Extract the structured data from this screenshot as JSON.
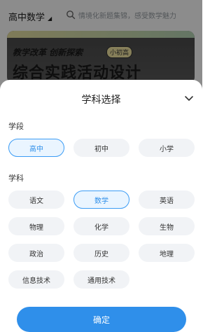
{
  "header": {
    "subject_label": "高中数学",
    "search_placeholder": "情境化新题集锦，感受数学魅力"
  },
  "banner": {
    "line1": "教学改革 创新探索",
    "tag": "小初高",
    "line2": "综合实践活动设计"
  },
  "sheet": {
    "title": "学科选择",
    "stage_label": "学段",
    "stages": [
      {
        "label": "高中",
        "selected": true
      },
      {
        "label": "初中",
        "selected": false
      },
      {
        "label": "小学",
        "selected": false
      }
    ],
    "subject_label": "学科",
    "subjects": [
      {
        "label": "语文",
        "selected": false
      },
      {
        "label": "数学",
        "selected": true
      },
      {
        "label": "英语",
        "selected": false
      },
      {
        "label": "物理",
        "selected": false
      },
      {
        "label": "化学",
        "selected": false
      },
      {
        "label": "生物",
        "selected": false
      },
      {
        "label": "政治",
        "selected": false
      },
      {
        "label": "历史",
        "selected": false
      },
      {
        "label": "地理",
        "selected": false
      },
      {
        "label": "信息技术",
        "selected": false
      },
      {
        "label": "通用技术",
        "selected": false
      }
    ],
    "confirm_label": "确定"
  },
  "colors": {
    "accent": "#2f8fea",
    "chip_bg": "#f1f3f6",
    "selected_bg": "#eaf5ff"
  },
  "icons": [
    "search-icon",
    "chevron-down-icon",
    "caret-down-icon"
  ]
}
